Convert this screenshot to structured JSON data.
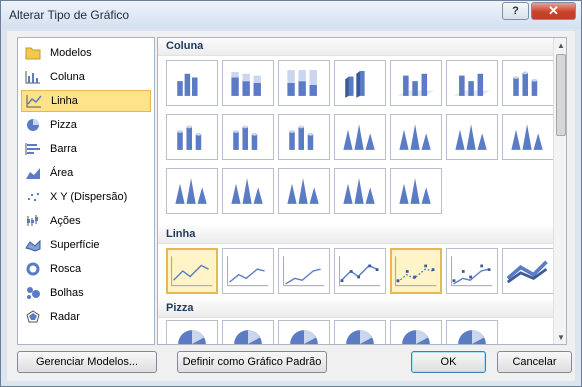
{
  "window": {
    "title": "Alterar Tipo de Gráfico",
    "help_label": "?",
    "close_label": "✕"
  },
  "categories": [
    {
      "label": "Modelos",
      "icon": "folder-icon"
    },
    {
      "label": "Coluna",
      "icon": "column-chart-icon"
    },
    {
      "label": "Linha",
      "icon": "line-chart-icon",
      "selected": true
    },
    {
      "label": "Pizza",
      "icon": "pie-chart-icon"
    },
    {
      "label": "Barra",
      "icon": "bar-chart-icon"
    },
    {
      "label": "Área",
      "icon": "area-chart-icon"
    },
    {
      "label": "X Y (Dispersão)",
      "icon": "scatter-chart-icon"
    },
    {
      "label": "Ações",
      "icon": "stock-chart-icon"
    },
    {
      "label": "Superfície",
      "icon": "surface-chart-icon"
    },
    {
      "label": "Rosca",
      "icon": "doughnut-chart-icon"
    },
    {
      "label": "Bolhas",
      "icon": "bubble-chart-icon"
    },
    {
      "label": "Radar",
      "icon": "radar-chart-icon"
    }
  ],
  "sections": [
    {
      "title": "Coluna",
      "tile_count": 19
    },
    {
      "title": "Linha",
      "tile_count": 7,
      "selected_index": 4
    },
    {
      "title": "Pizza",
      "tile_count": 6
    }
  ],
  "buttons": {
    "manage": "Gerenciar Modelos...",
    "set_default": "Definir como Gráfico Padrão",
    "ok": "OK",
    "cancel": "Cancelar"
  },
  "colors": {
    "selection": "#ffe28a",
    "chart_blue": "#5b7cc4",
    "header_text": "#1e395b"
  }
}
